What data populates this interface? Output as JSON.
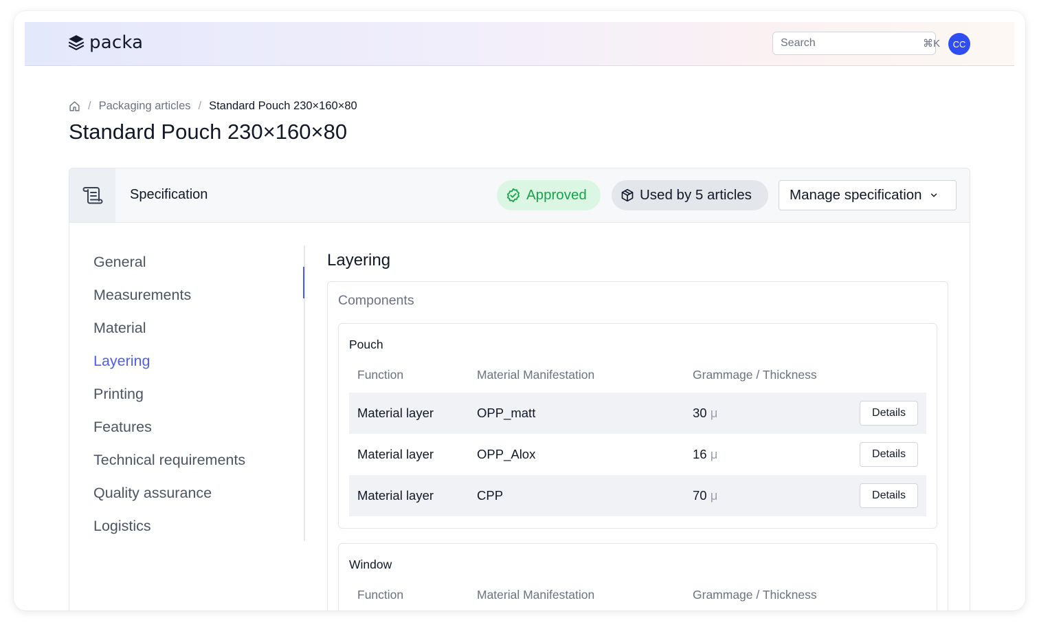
{
  "app": {
    "brand": "packa",
    "accent_color": "#4f5ee9",
    "avatar_color": "#2f4df0"
  },
  "header": {
    "search": {
      "placeholder": "Search",
      "shortcut": "⌘K"
    },
    "avatar_initials": "CC"
  },
  "breadcrumb": {
    "home_icon": "home-icon",
    "items": [
      "Packaging articles",
      "Standard Pouch 230×160×80"
    ],
    "separator": "/"
  },
  "page_title": "Standard Pouch 230×160×80",
  "spec": {
    "icon": "scroll-icon",
    "title": "Specification",
    "status": {
      "label": "Approved",
      "icon": "check-badge-icon",
      "color": "#16a34a"
    },
    "usage": {
      "label": "Used by 5 articles",
      "icon": "cube-icon"
    },
    "manage_label": "Manage specification"
  },
  "nav": {
    "active": "Layering",
    "items": [
      "General",
      "Measurements",
      "Material",
      "Layering",
      "Printing",
      "Features",
      "Technical requirements",
      "Quality assurance",
      "Logistics"
    ]
  },
  "layering": {
    "title": "Layering",
    "components_label": "Components",
    "columns": [
      "Function",
      "Material Manifestation",
      "Grammage / Thickness"
    ],
    "groups": [
      {
        "name": "Pouch",
        "rows": [
          {
            "function": "Material layer",
            "material": "OPP_matt",
            "value": "30",
            "unit": "μ",
            "action": "Details"
          },
          {
            "function": "Material layer",
            "material": "OPP_Alox",
            "value": "16",
            "unit": "μ",
            "action": "Details"
          },
          {
            "function": "Material layer",
            "material": "CPP",
            "value": "70",
            "unit": "μ",
            "action": "Details"
          }
        ]
      },
      {
        "name": "Window",
        "rows": []
      }
    ]
  }
}
